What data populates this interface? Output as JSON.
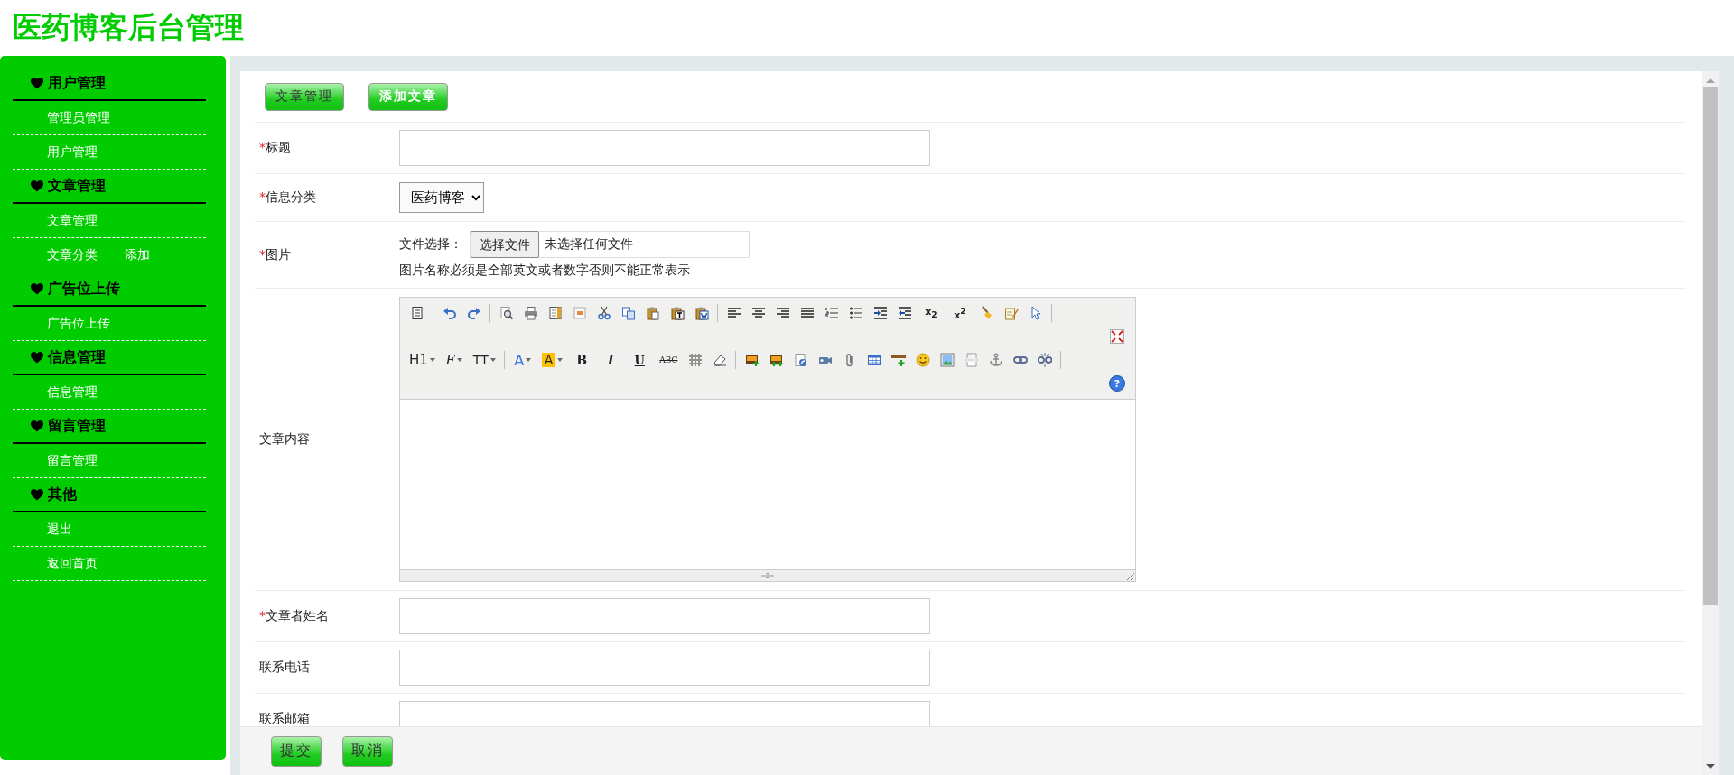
{
  "header": {
    "title": "医药博客后台管理"
  },
  "sidebar": {
    "groups": [
      {
        "heading": "用户管理",
        "items": [
          {
            "links": [
              "管理员管理"
            ]
          },
          {
            "links": [
              "用户管理"
            ]
          }
        ]
      },
      {
        "heading": "文章管理",
        "items": [
          {
            "links": [
              "文章管理"
            ]
          },
          {
            "links": [
              "文章分类",
              "添加"
            ]
          }
        ]
      },
      {
        "heading": "广告位上传",
        "items": [
          {
            "links": [
              "广告位上传"
            ]
          }
        ]
      },
      {
        "heading": "信息管理",
        "items": [
          {
            "links": [
              "信息管理"
            ]
          }
        ]
      },
      {
        "heading": "留言管理",
        "items": [
          {
            "links": [
              "留言管理"
            ]
          }
        ]
      },
      {
        "heading": "其他",
        "items": [
          {
            "links": [
              "退出"
            ]
          },
          {
            "links": [
              "返回首页"
            ]
          }
        ]
      }
    ]
  },
  "tabs": [
    {
      "label": "文章管理",
      "selected": false
    },
    {
      "label": "添加文章",
      "selected": true
    }
  ],
  "form": {
    "rows": [
      {
        "kind": "text",
        "required_mark": "*",
        "label": "标题"
      },
      {
        "kind": "select",
        "required_mark": "*",
        "label": "信息分类",
        "value": "医药博客"
      },
      {
        "kind": "file",
        "required_mark": "*",
        "label": "图片",
        "prefix": "文件选择：",
        "button": "选择文件",
        "status": "未选择任何文件",
        "hint": "图片名称必须是全部英文或者数字否则不能正常表示"
      },
      {
        "kind": "editor",
        "label": "文章内容"
      },
      {
        "kind": "text",
        "required_mark": "*",
        "label": "文章者姓名"
      },
      {
        "kind": "text",
        "label": "联系电话"
      },
      {
        "kind": "text",
        "label": "联系邮箱"
      }
    ]
  },
  "editor": {
    "toolbar_labels": [
      {
        "kind": "subscript",
        "text": "x$_{2}$"
      },
      {
        "kind": "superscript",
        "text": "x$^{2}$"
      },
      {
        "kind": "heading",
        "text": "H1"
      },
      {
        "kind": "font-family",
        "text": "F"
      },
      {
        "kind": "font-size",
        "text": "TT"
      },
      {
        "kind": "fore-color",
        "text": "A"
      },
      {
        "kind": "back-color",
        "text": "A"
      },
      {
        "kind": "bold",
        "text": "B"
      },
      {
        "kind": "italic",
        "text": "I"
      },
      {
        "kind": "underline",
        "text": "U"
      },
      {
        "kind": "strike",
        "text": "ABC"
      },
      {
        "kind": "help",
        "text": "?"
      }
    ]
  },
  "footer": {
    "buttons": [
      "提交",
      "取消"
    ]
  }
}
